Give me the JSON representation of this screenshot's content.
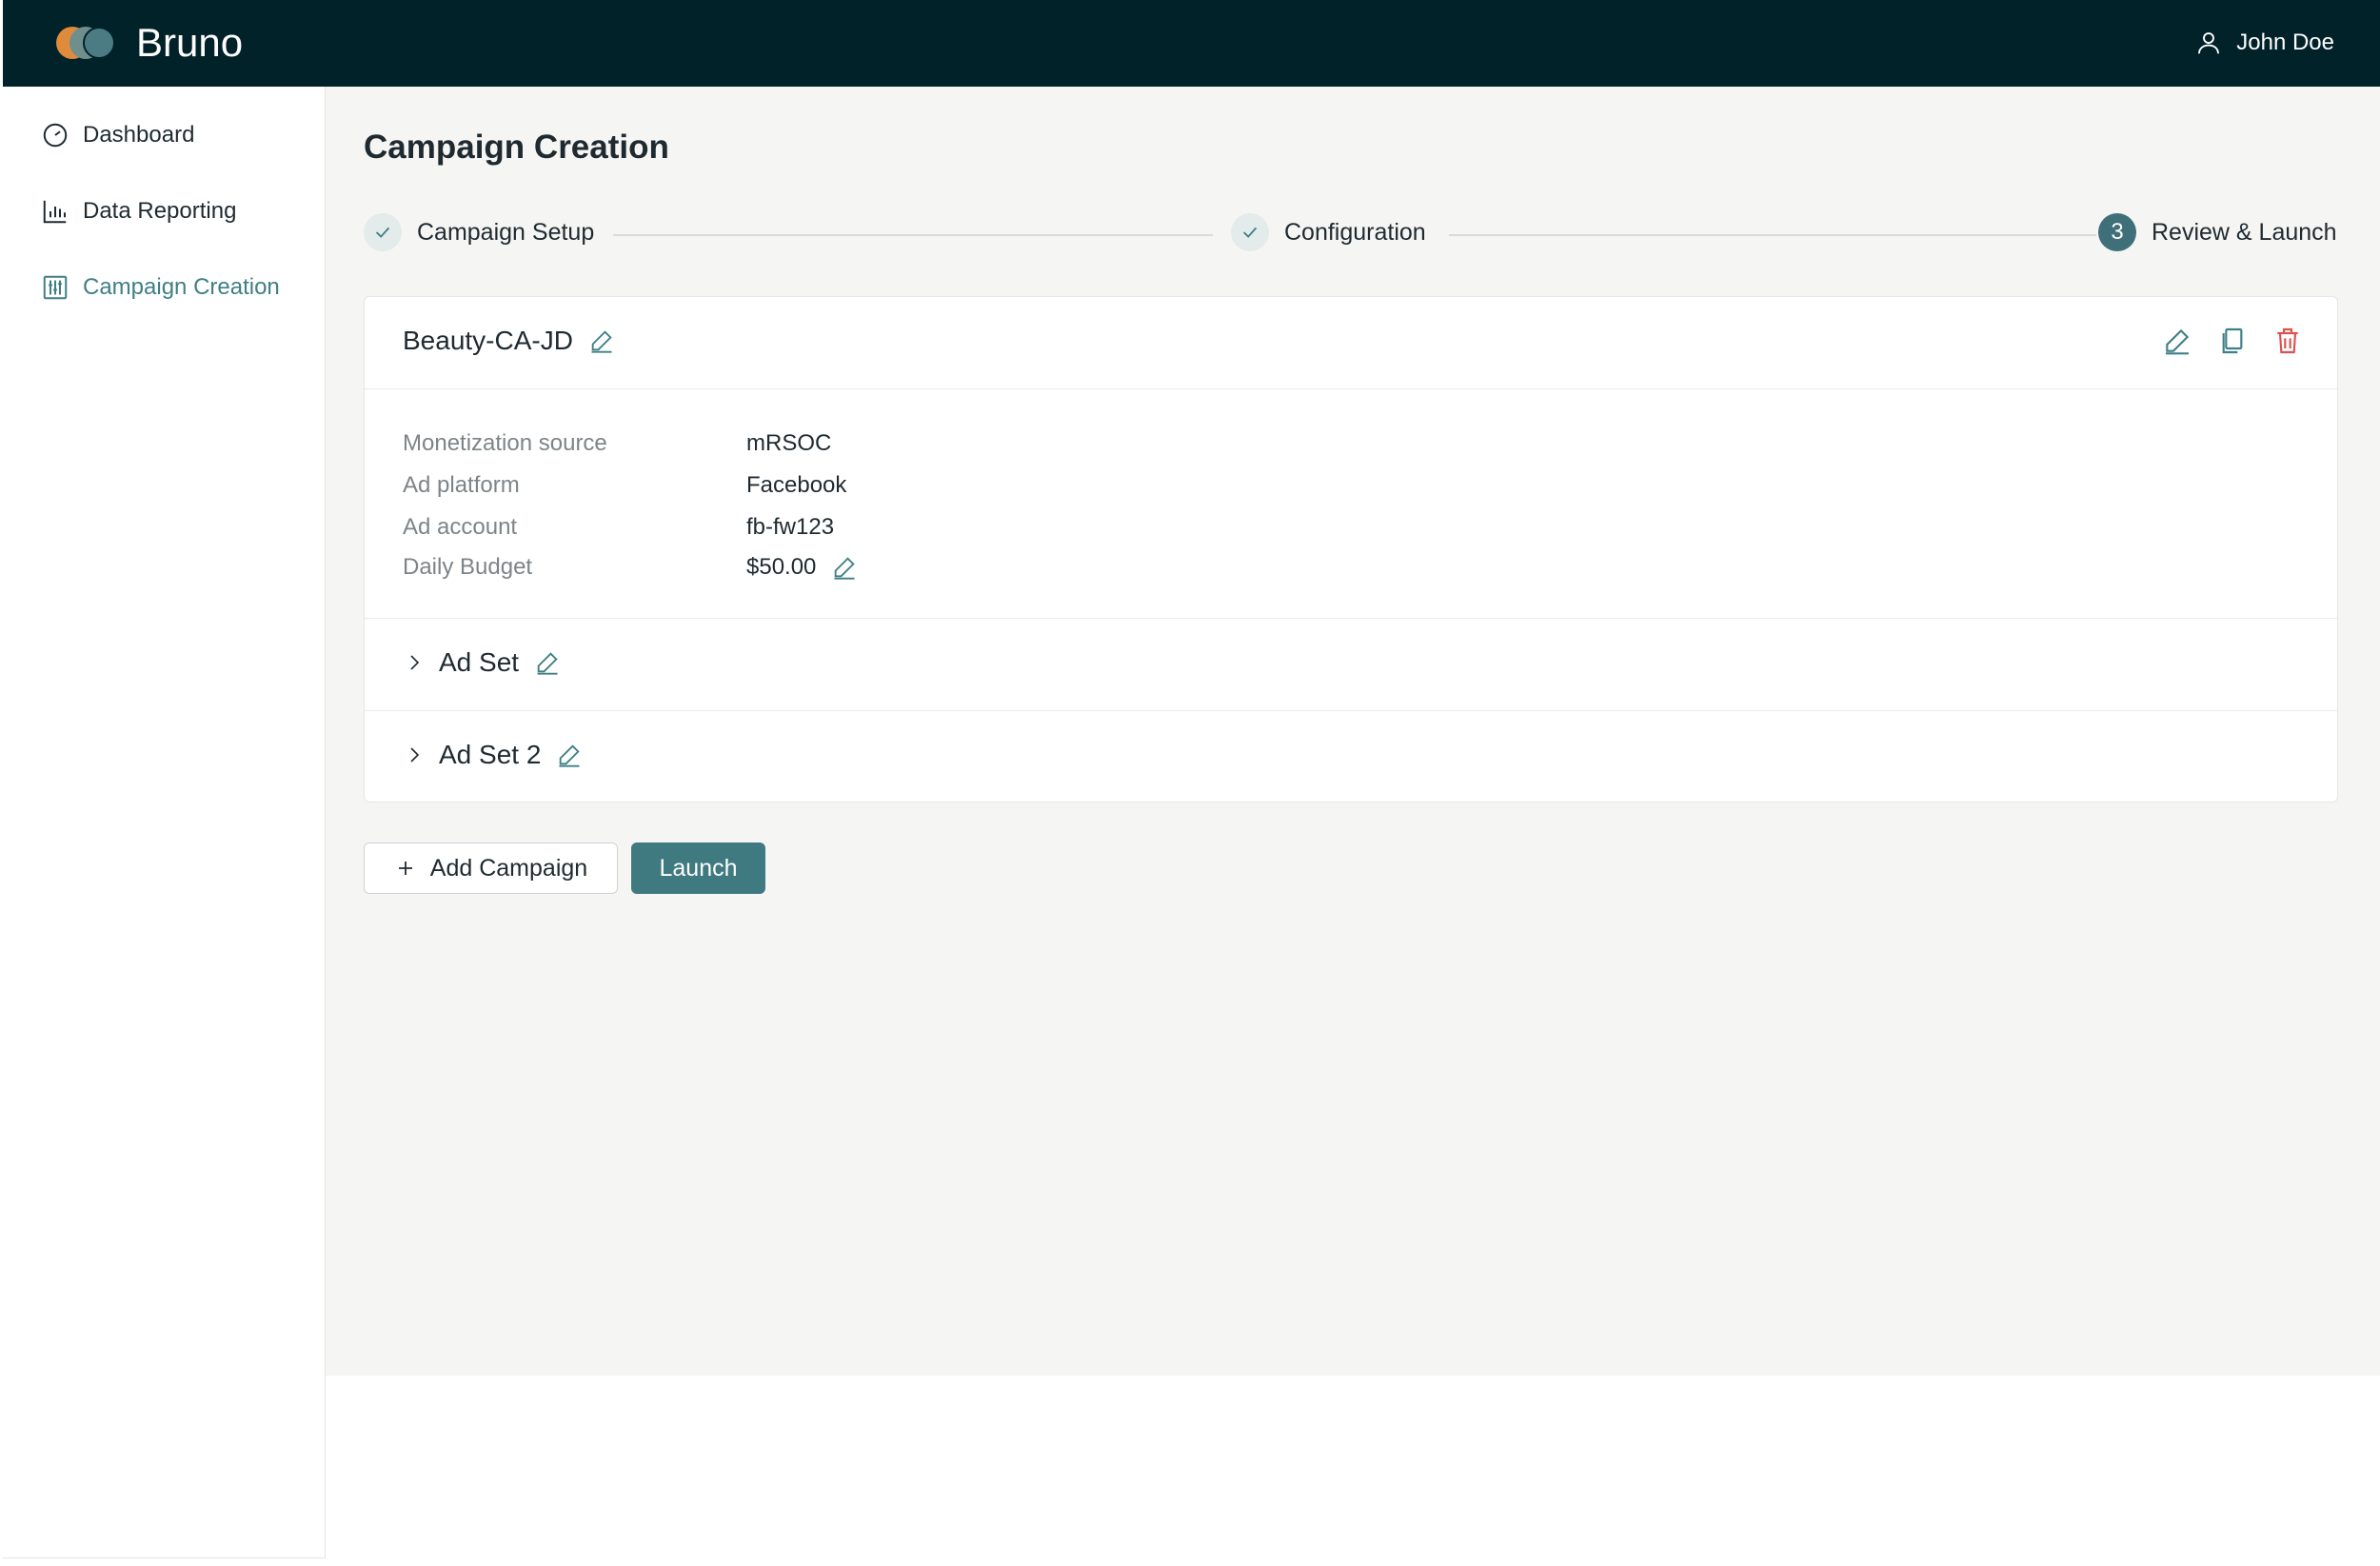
{
  "app": {
    "name": "Bruno"
  },
  "user": {
    "name": "John Doe"
  },
  "sidebar": {
    "items": [
      {
        "label": "Dashboard",
        "icon": "dashboard-gauge-icon"
      },
      {
        "label": "Data Reporting",
        "icon": "bar-chart-icon"
      },
      {
        "label": "Campaign Creation",
        "icon": "sliders-icon",
        "active": true
      }
    ]
  },
  "main": {
    "title": "Campaign Creation",
    "stepper": {
      "steps": [
        {
          "label": "Campaign Setup",
          "status": "completed"
        },
        {
          "label": "Configuration",
          "status": "completed"
        },
        {
          "label": "Review & Launch",
          "status": "current",
          "number": "3"
        }
      ]
    },
    "campaign": {
      "name": "Beauty-CA-JD",
      "details": [
        {
          "label": "Monetization source",
          "value": "mRSOC"
        },
        {
          "label": "Ad platform",
          "value": "Facebook"
        },
        {
          "label": "Ad account",
          "value": "fb-fw123"
        },
        {
          "label": "Daily Budget",
          "value": "$50.00",
          "editable": true
        }
      ],
      "ad_sets": [
        {
          "label": "Ad Set"
        },
        {
          "label": "Ad Set 2"
        }
      ]
    },
    "buttons": {
      "add_campaign": "Add Campaign",
      "launch": "Launch"
    }
  },
  "colors": {
    "header_bg": "#02222a",
    "accent": "#3f7f86",
    "primary_button": "#3f7a80",
    "delete": "#d9534f",
    "page_bg": "#f5f5f3"
  }
}
